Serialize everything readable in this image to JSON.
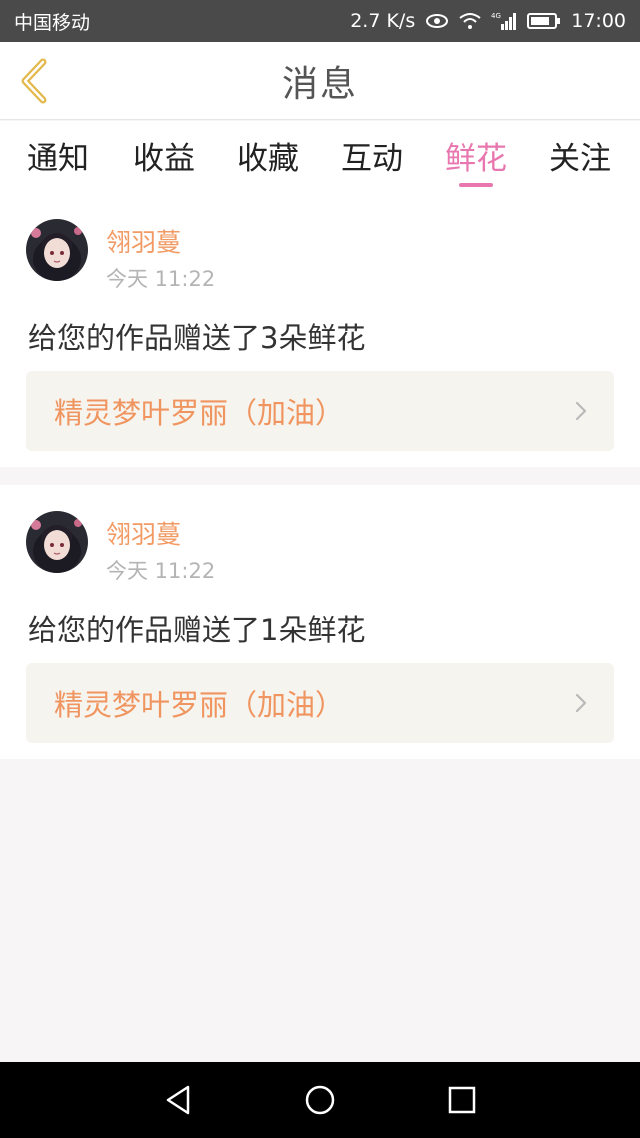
{
  "status_bar": {
    "carrier": "中国移动",
    "speed": "2.7 K/s",
    "network": "4G",
    "time": "17:00",
    "icons": [
      "eye-icon",
      "wifi-icon",
      "signal-icon",
      "battery-icon"
    ]
  },
  "header": {
    "title": "消息",
    "back_icon": "chevron-left-icon"
  },
  "tabs": [
    {
      "label": "通知",
      "active": false
    },
    {
      "label": "收益",
      "active": false
    },
    {
      "label": "收藏",
      "active": false
    },
    {
      "label": "互动",
      "active": false
    },
    {
      "label": "鲜花",
      "active": true
    },
    {
      "label": "关注",
      "active": false
    }
  ],
  "messages": [
    {
      "username": "翎羽蔓",
      "time": "今天 11:22",
      "text": "给您的作品赠送了3朵鲜花",
      "work_title": "精灵梦叶罗丽（加油）"
    },
    {
      "username": "翎羽蔓",
      "time": "今天 11:22",
      "text": "给您的作品赠送了1朵鲜花",
      "work_title": "精灵梦叶罗丽（加油）"
    }
  ],
  "colors": {
    "accent": "#e777ae",
    "username": "#f29a63",
    "work_title": "#f0955f",
    "back_icon": "#e3b84a"
  },
  "nav_bar": {
    "icons": [
      "back-triangle-icon",
      "home-circle-icon",
      "recents-square-icon"
    ]
  }
}
